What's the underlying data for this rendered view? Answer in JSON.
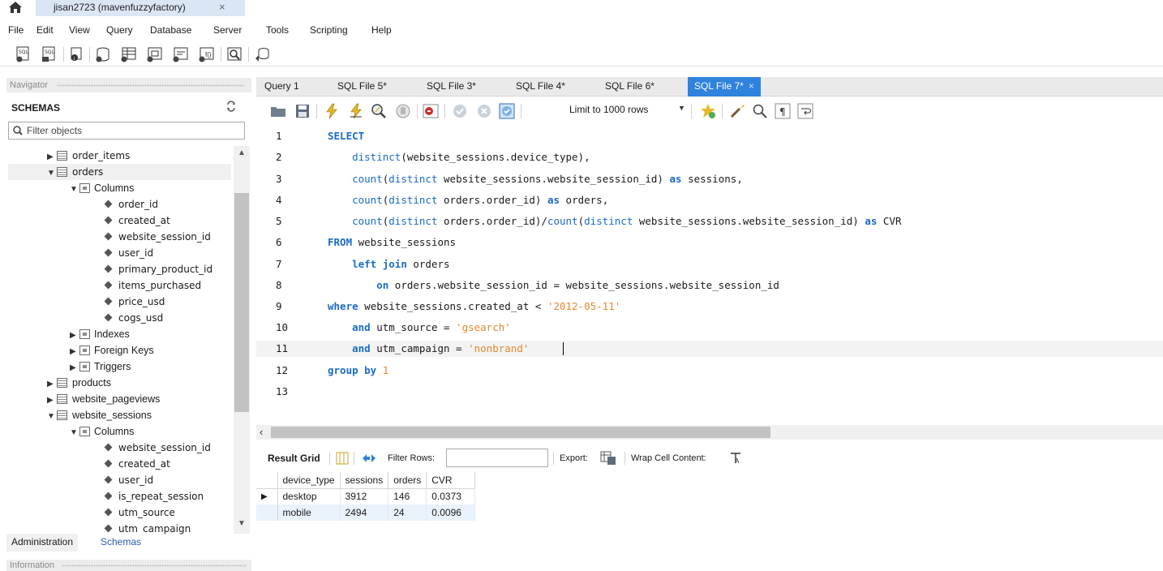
{
  "window": {
    "connection_tab": "jisan2723 (mavenfuzzyfactory)",
    "close_glyph": "×"
  },
  "menu": [
    "File",
    "Edit",
    "View",
    "Query",
    "Database",
    "Server",
    "Tools",
    "Scripting",
    "Help"
  ],
  "navigator": {
    "header": "Navigator",
    "schemas_label": "SCHEMAS",
    "filter_placeholder": "Filter objects",
    "tree": [
      {
        "label": "order_items",
        "type": "table",
        "expanded": false
      },
      {
        "label": "orders",
        "type": "table",
        "expanded": true
      },
      {
        "label": "Columns",
        "type": "folder",
        "expanded": true
      },
      {
        "label": "order_id",
        "type": "column"
      },
      {
        "label": "created_at",
        "type": "column"
      },
      {
        "label": "website_session_id",
        "type": "column"
      },
      {
        "label": "user_id",
        "type": "column"
      },
      {
        "label": "primary_product_id",
        "type": "column"
      },
      {
        "label": "items_purchased",
        "type": "column"
      },
      {
        "label": "price_usd",
        "type": "column"
      },
      {
        "label": "cogs_usd",
        "type": "column"
      },
      {
        "label": "Indexes",
        "type": "folder",
        "expanded": false
      },
      {
        "label": "Foreign Keys",
        "type": "folder",
        "expanded": false
      },
      {
        "label": "Triggers",
        "type": "folder",
        "expanded": false
      },
      {
        "label": "products",
        "type": "table",
        "expanded": false
      },
      {
        "label": "website_pageviews",
        "type": "table",
        "expanded": false
      },
      {
        "label": "website_sessions",
        "type": "table",
        "expanded": true
      },
      {
        "label": "Columns",
        "type": "folder",
        "expanded": true
      },
      {
        "label": "website_session_id",
        "type": "column"
      },
      {
        "label": "created_at",
        "type": "column"
      },
      {
        "label": "user_id",
        "type": "column"
      },
      {
        "label": "is_repeat_session",
        "type": "column"
      },
      {
        "label": "utm_source",
        "type": "column"
      },
      {
        "label": "utm_campaign",
        "type": "column"
      }
    ],
    "tab_admin": "Administration",
    "tab_schemas": "Schemas",
    "info_header": "Information"
  },
  "editor_tabs": [
    "Query 1",
    "SQL File 5*",
    "SQL File 3*",
    "SQL File 4*",
    "SQL File 6*",
    "SQL File 7*"
  ],
  "editor_toolbar": {
    "limit_label": "Limit to 1000 rows"
  },
  "editor": {
    "line_numbers": [
      "1",
      "2",
      "3",
      "4",
      "5",
      "6",
      "7",
      "8",
      "9",
      "10",
      "11",
      "12",
      "13"
    ]
  },
  "result": {
    "grid_label": "Result Grid",
    "filter_rows_label": "Filter Rows:",
    "export_label": "Export:",
    "wrap_label": "Wrap Cell Content:",
    "columns": [
      "device_type",
      "sessions",
      "orders",
      "CVR"
    ],
    "rows": [
      [
        "desktop",
        "3912",
        "146",
        "0.0373"
      ],
      [
        "mobile",
        "2494",
        "24",
        "0.0096"
      ]
    ],
    "current_row_marker": "▶"
  },
  "colors": {
    "keyword": "#1a6bc7",
    "string": "#e2892d",
    "active_tab": "#2f83dd"
  }
}
